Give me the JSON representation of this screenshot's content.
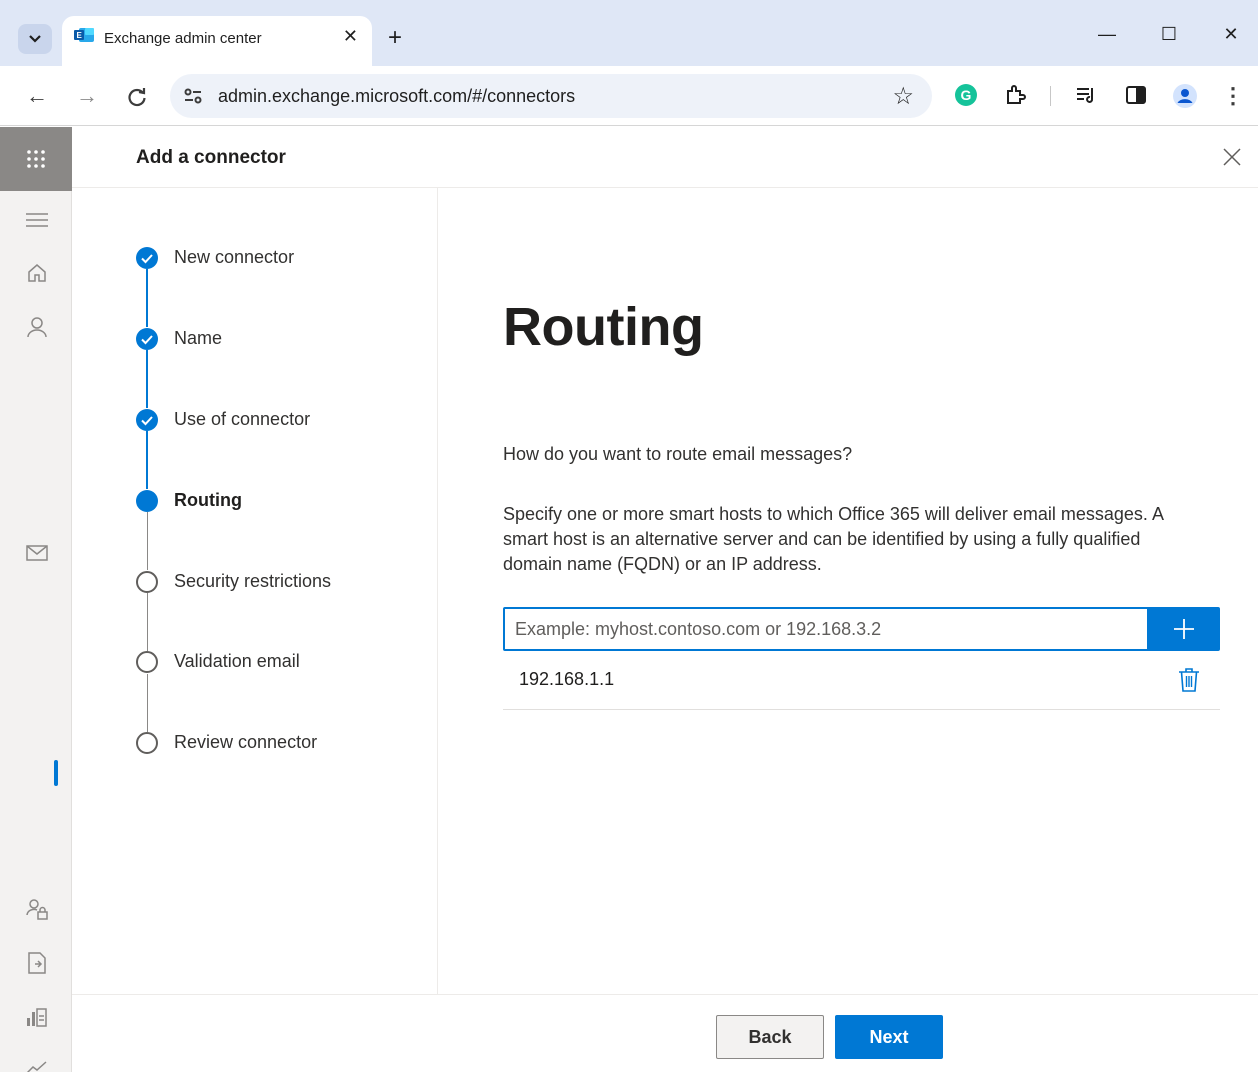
{
  "browser": {
    "tab_title": "Exchange admin center",
    "tab_close": "✕",
    "new_tab": "+",
    "url": "admin.exchange.microsoft.com/#/connectors",
    "minimize": "—",
    "maximize": "☐",
    "close": "✕",
    "back": "←",
    "forward": "→",
    "reload": "C",
    "star": "☆",
    "menu": "⋮"
  },
  "panel": {
    "title": "Add a connector"
  },
  "steps": [
    {
      "label": "New connector",
      "state": "done"
    },
    {
      "label": "Name",
      "state": "done"
    },
    {
      "label": "Use of connector",
      "state": "done"
    },
    {
      "label": "Routing",
      "state": "current"
    },
    {
      "label": "Security restrictions",
      "state": "todo"
    },
    {
      "label": "Validation email",
      "state": "todo"
    },
    {
      "label": "Review connector",
      "state": "todo"
    }
  ],
  "routing": {
    "heading": "Routing",
    "question": "How do you want to route email messages?",
    "description": "Specify one or more smart hosts to which Office 365 will deliver email messages. A smart host is an alternative server and can be identified by using a fully qualified domain name (FQDN) or an IP address.",
    "input_placeholder": "Example: myhost.contoso.com or 192.168.3.2",
    "input_value": "",
    "hosts": [
      "192.168.1.1"
    ]
  },
  "footer": {
    "back_label": "Back",
    "next_label": "Next"
  },
  "colors": {
    "accent": "#0078d4",
    "rail_bg": "#f3f2f1",
    "tabstrip_bg": "#dfe7f6"
  }
}
